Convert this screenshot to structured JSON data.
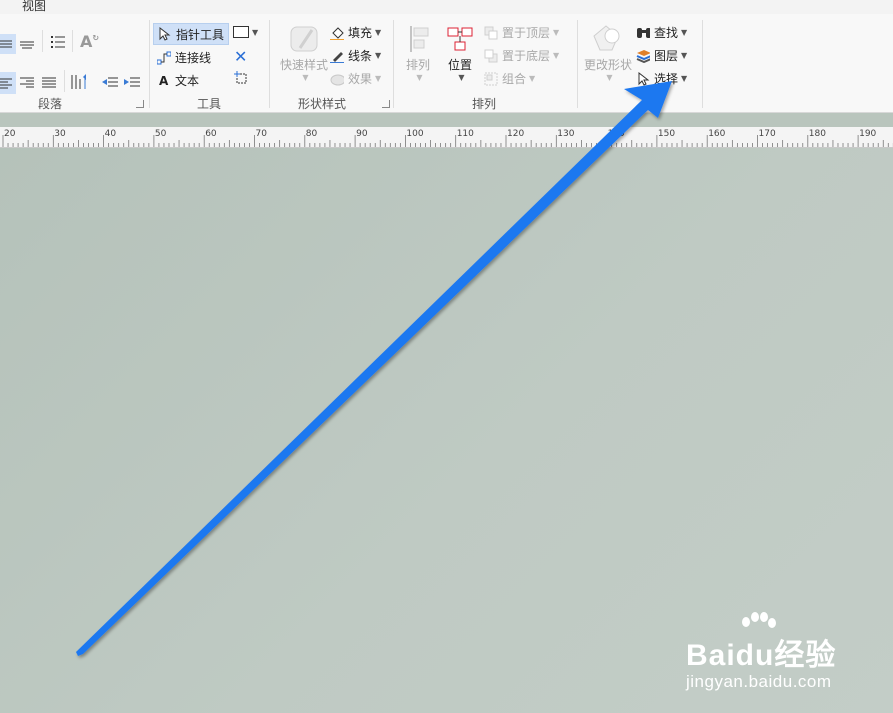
{
  "tabs": {
    "view": "视图"
  },
  "ribbon": {
    "paragraph": {
      "label": "段落"
    },
    "tools": {
      "label": "工具",
      "pointer": "指针工具",
      "connector": "连接线",
      "text": "文本"
    },
    "shape_styles": {
      "label": "形状样式",
      "quick_styles": "快速样式",
      "fill": "填充",
      "line": "线条",
      "effects": "效果"
    },
    "arrange": {
      "label": "排列",
      "align": "排列",
      "position": "位置",
      "bring_to_front": "置于顶层",
      "send_to_back": "置于底层",
      "group": "组合"
    },
    "editing": {
      "change_shape": "更改形状",
      "find": "查找",
      "layers": "图层",
      "select": "选择"
    }
  },
  "ruler": {
    "numbers": [
      "20",
      "30",
      "40",
      "50",
      "60",
      "70",
      "80",
      "90",
      "100",
      "110",
      "120",
      "130",
      "140",
      "150",
      "160",
      "170",
      "180",
      "190"
    ]
  },
  "watermark": {
    "brand": "Baidu经验",
    "url": "jingyan.baidu.com"
  },
  "colors": {
    "arrow": "#1e78f0",
    "canvas": "#b9c5bd",
    "ribbon": "#f8f8f8",
    "selected_tool": "#cfe0f7"
  }
}
